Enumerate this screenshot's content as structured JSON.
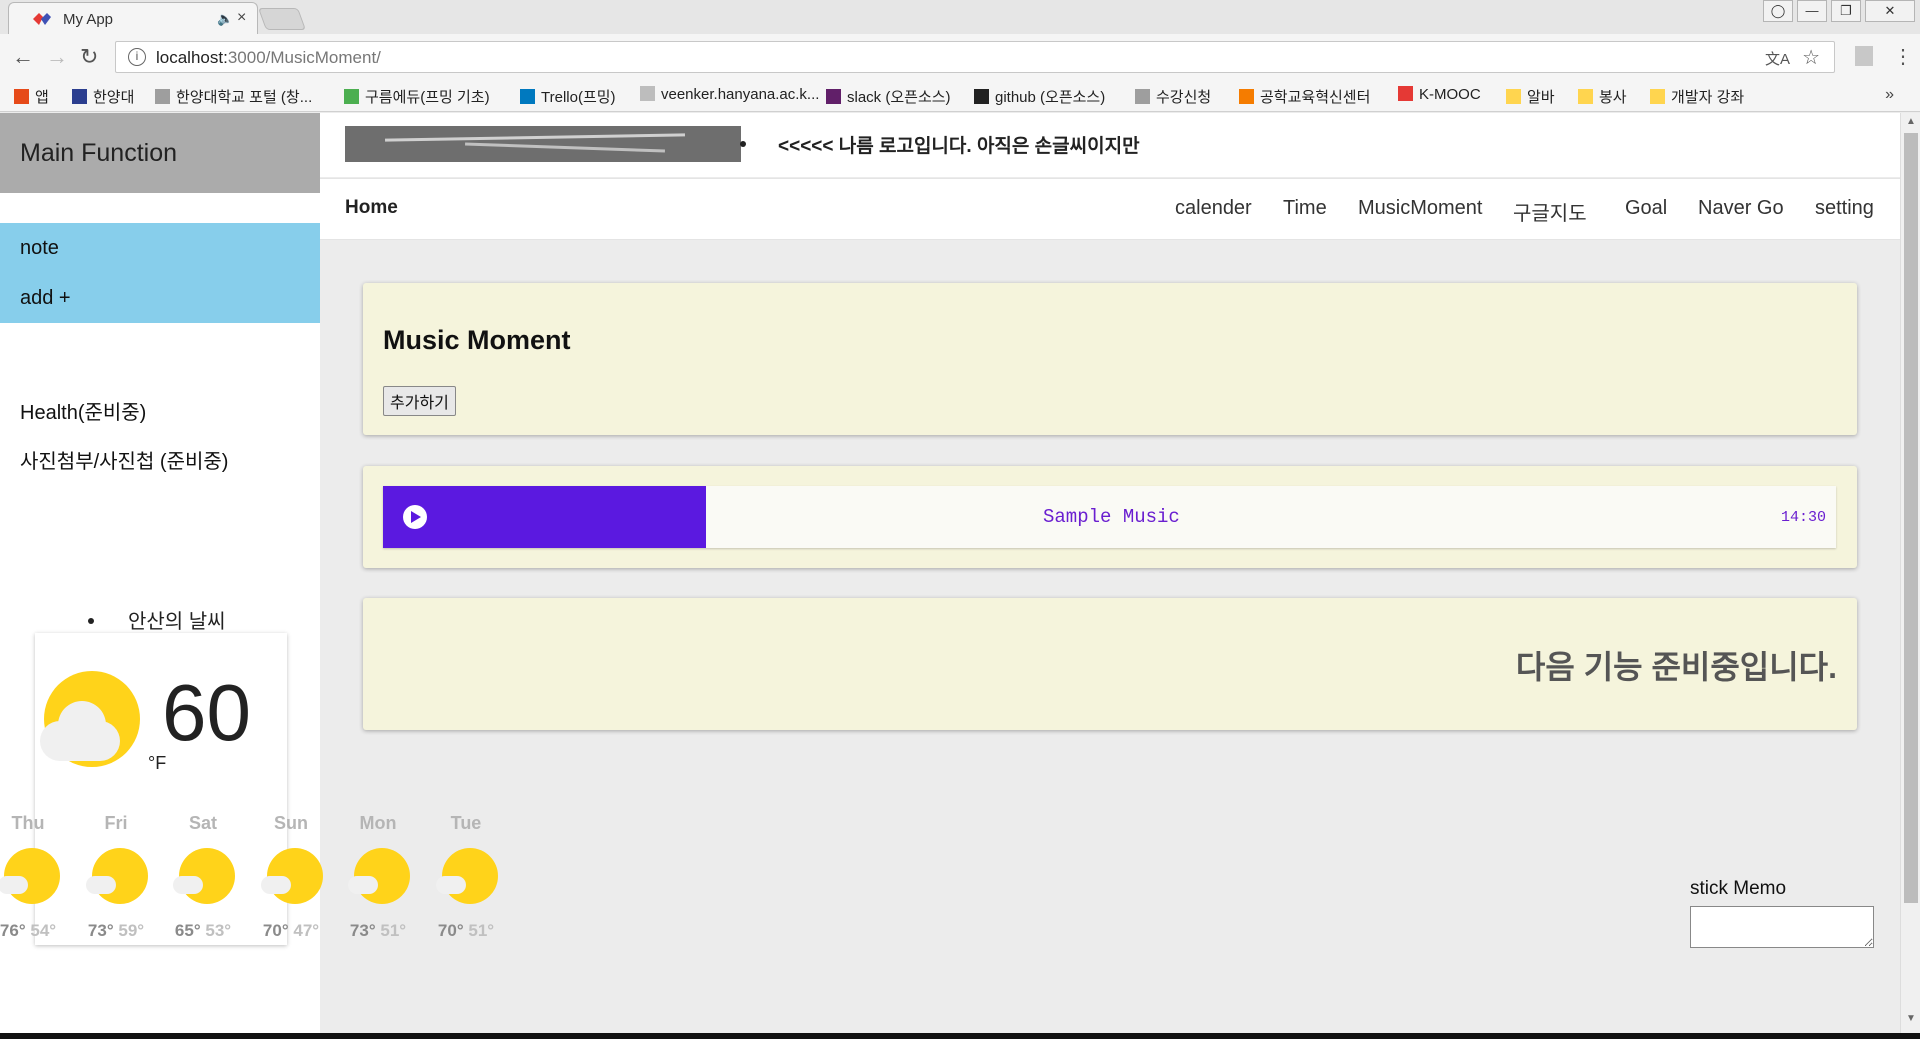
{
  "browser": {
    "tab_title": "My App",
    "tab_close": "×",
    "tab_speaker": "🔈",
    "url_host": "localhost:",
    "url_rest": "3000/MusicMoment/",
    "info_icon": "i",
    "translate_icon": "文A",
    "star_icon": "☆",
    "menu_icon": "⋮",
    "back_icon": "←",
    "forward_icon": "→",
    "reload_icon": "↻",
    "more_bookmarks": "»",
    "window_buttons": [
      "◯",
      "—",
      "❐",
      "✕"
    ]
  },
  "bookmarks": [
    {
      "label": "앱",
      "icon_color": "#e64a19"
    },
    {
      "label": "한양대",
      "icon_color": "#2b3e8f"
    },
    {
      "label": "한양대학교 포털 (창...",
      "icon_color": "#9e9e9e"
    },
    {
      "label": "구름에듀(프밍 기초)",
      "icon_color": "#4caf50"
    },
    {
      "label": "Trello(프밍)",
      "icon_color": "#0079bf"
    },
    {
      "label": "veenker.hanyana.ac.k...",
      "icon_color": "#bdbdbd"
    },
    {
      "label": "slack (오픈소스)",
      "icon_color": "#611f69"
    },
    {
      "label": "github (오픈소스)",
      "icon_color": "#222222"
    },
    {
      "label": "수강신청",
      "icon_color": "#9e9e9e"
    },
    {
      "label": "공학교육혁신센터",
      "icon_color": "#f57c00"
    },
    {
      "label": "K-MOOC",
      "icon_color": "#e53935"
    },
    {
      "label": "알바",
      "icon_color": "#ffd54f"
    },
    {
      "label": "봉사",
      "icon_color": "#ffd54f"
    },
    {
      "label": "개발자 강좌",
      "icon_color": "#ffd54f"
    }
  ],
  "sidebar": {
    "title": "Main Function",
    "items": [
      "note",
      "add +",
      "Health(준비중)",
      "사진첨부/사진첩 (준비중)"
    ],
    "accent_color": "#87ceeb"
  },
  "weather": {
    "title": "안산의 날씨",
    "current_temp": "60",
    "unit": "°F",
    "forecast": [
      {
        "day": "Thu",
        "high": "76°",
        "low": "54°"
      },
      {
        "day": "Fri",
        "high": "73°",
        "low": "59°"
      },
      {
        "day": "Sat",
        "high": "65°",
        "low": "53°"
      },
      {
        "day": "Sun",
        "high": "70°",
        "low": "47°"
      },
      {
        "day": "Mon",
        "high": "73°",
        "low": "51°"
      },
      {
        "day": "Tue",
        "high": "70°",
        "low": "51°"
      }
    ]
  },
  "header": {
    "logo_caption": "<<<<< 나름 로고입니다. 아직은 손글씨이지만",
    "nav_home": "Home",
    "nav_links": [
      "calender",
      "Time",
      "MusicMoment",
      "구글지도",
      "Goal",
      "Naver Go",
      "setting"
    ]
  },
  "music": {
    "title": "Music Moment",
    "add_button": "추가하기",
    "track_name": "Sample Music",
    "track_time": "14:30",
    "accent_color": "#5b19e0"
  },
  "coming_soon": "다음 기능 준비중입니다.",
  "memo": {
    "label": "stick Memo",
    "value": ""
  }
}
